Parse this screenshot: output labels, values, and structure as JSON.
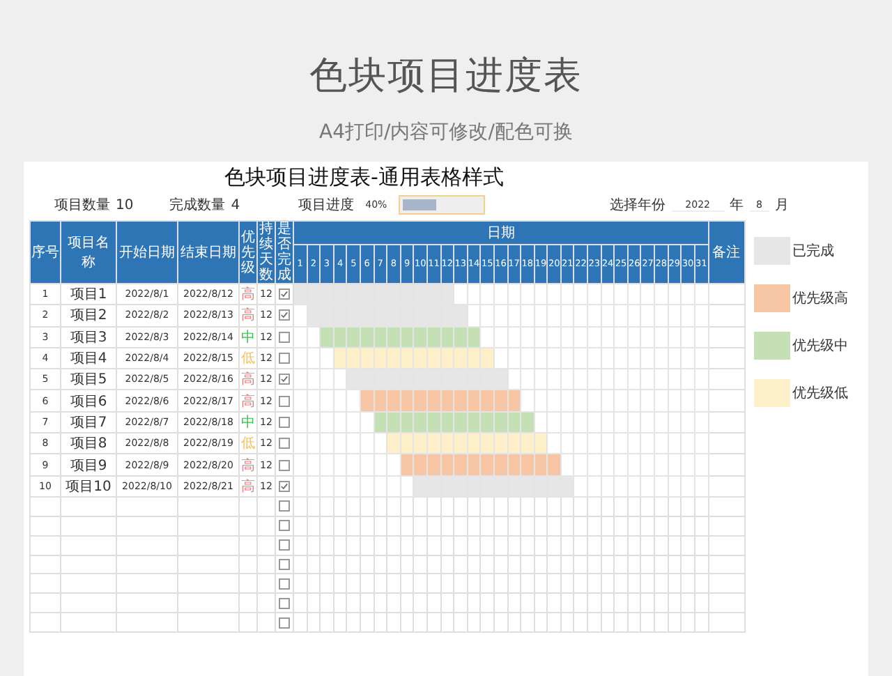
{
  "page_title": "色块项目进度表",
  "subtitle": "A4打印/内容可修改/配色可换",
  "sheet": {
    "title": "色块项目进度表-通用表格样式",
    "summary": {
      "count_label": "项目数量",
      "count": "10",
      "done_label": "完成数量",
      "done": "4",
      "progress_label": "项目进度",
      "progress_text": "40%",
      "level": 0.4,
      "year_label": "选择年份",
      "year": "2022",
      "year_unit": "年",
      "month": "8",
      "month_unit": "月"
    },
    "columns": [
      "序号",
      "项目名称",
      "开始日期",
      "结束日期",
      "优先级",
      "持续天数",
      "是否完成"
    ],
    "date_header": "日期",
    "days": [
      "1",
      "2",
      "3",
      "4",
      "5",
      "6",
      "7",
      "8",
      "9",
      "10",
      "11",
      "12",
      "13",
      "14",
      "15",
      "16",
      "17",
      "18",
      "19",
      "20",
      "21",
      "22",
      "23",
      "24",
      "25",
      "26",
      "27",
      "28",
      "29",
      "30",
      "31"
    ],
    "remark_header": "备注",
    "rows": [
      {
        "no": "1",
        "name": "项目1",
        "start": "2022/8/1",
        "end": "2022/8/12",
        "priority": "高",
        "kind": "high",
        "days": "12",
        "done": true,
        "timeline": [
          true,
          true,
          true,
          true,
          true,
          true,
          true,
          true,
          true,
          true,
          true,
          true,
          false,
          false,
          false,
          false,
          false,
          false,
          false,
          false,
          false,
          false,
          false,
          false,
          false,
          false,
          false,
          false,
          false,
          false,
          false
        ]
      },
      {
        "no": "2",
        "name": "项目2",
        "start": "2022/8/2",
        "end": "2022/8/13",
        "priority": "高",
        "kind": "high",
        "days": "12",
        "done": true,
        "timeline": [
          false,
          true,
          true,
          true,
          true,
          true,
          true,
          true,
          true,
          true,
          true,
          true,
          true,
          false,
          false,
          false,
          false,
          false,
          false,
          false,
          false,
          false,
          false,
          false,
          false,
          false,
          false,
          false,
          false,
          false,
          false
        ]
      },
      {
        "no": "3",
        "name": "项目3",
        "start": "2022/8/3",
        "end": "2022/8/14",
        "priority": "中",
        "kind": "medium",
        "days": "12",
        "done": false,
        "timeline": [
          false,
          false,
          true,
          true,
          true,
          true,
          true,
          true,
          true,
          true,
          true,
          true,
          true,
          true,
          false,
          false,
          false,
          false,
          false,
          false,
          false,
          false,
          false,
          false,
          false,
          false,
          false,
          false,
          false,
          false,
          false
        ]
      },
      {
        "no": "4",
        "name": "项目4",
        "start": "2022/8/4",
        "end": "2022/8/15",
        "priority": "低",
        "kind": "low",
        "days": "12",
        "done": false,
        "timeline": [
          false,
          false,
          false,
          true,
          true,
          true,
          true,
          true,
          true,
          true,
          true,
          true,
          true,
          true,
          true,
          false,
          false,
          false,
          false,
          false,
          false,
          false,
          false,
          false,
          false,
          false,
          false,
          false,
          false,
          false,
          false
        ]
      },
      {
        "no": "5",
        "name": "项目5",
        "start": "2022/8/5",
        "end": "2022/8/16",
        "priority": "高",
        "kind": "high",
        "days": "12",
        "done": true,
        "timeline": [
          false,
          false,
          false,
          false,
          true,
          true,
          true,
          true,
          true,
          true,
          true,
          true,
          true,
          true,
          true,
          true,
          false,
          false,
          false,
          false,
          false,
          false,
          false,
          false,
          false,
          false,
          false,
          false,
          false,
          false,
          false
        ]
      },
      {
        "no": "6",
        "name": "项目6",
        "start": "2022/8/6",
        "end": "2022/8/17",
        "priority": "高",
        "kind": "high",
        "days": "12",
        "done": false,
        "timeline": [
          false,
          false,
          false,
          false,
          false,
          true,
          true,
          true,
          true,
          true,
          true,
          true,
          true,
          true,
          true,
          true,
          true,
          false,
          false,
          false,
          false,
          false,
          false,
          false,
          false,
          false,
          false,
          false,
          false,
          false,
          false
        ]
      },
      {
        "no": "7",
        "name": "项目7",
        "start": "2022/8/7",
        "end": "2022/8/18",
        "priority": "中",
        "kind": "medium",
        "days": "12",
        "done": false,
        "timeline": [
          false,
          false,
          false,
          false,
          false,
          false,
          true,
          true,
          true,
          true,
          true,
          true,
          true,
          true,
          true,
          true,
          true,
          true,
          false,
          false,
          false,
          false,
          false,
          false,
          false,
          false,
          false,
          false,
          false,
          false,
          false
        ]
      },
      {
        "no": "8",
        "name": "项目8",
        "start": "2022/8/8",
        "end": "2022/8/19",
        "priority": "低",
        "kind": "low",
        "days": "12",
        "done": false,
        "timeline": [
          false,
          false,
          false,
          false,
          false,
          false,
          false,
          true,
          true,
          true,
          true,
          true,
          true,
          true,
          true,
          true,
          true,
          true,
          true,
          false,
          false,
          false,
          false,
          false,
          false,
          false,
          false,
          false,
          false,
          false,
          false
        ]
      },
      {
        "no": "9",
        "name": "项目9",
        "start": "2022/8/9",
        "end": "2022/8/20",
        "priority": "高",
        "kind": "high",
        "days": "12",
        "done": false,
        "timeline": [
          false,
          false,
          false,
          false,
          false,
          false,
          false,
          false,
          true,
          true,
          true,
          true,
          true,
          true,
          true,
          true,
          true,
          true,
          true,
          true,
          false,
          false,
          false,
          false,
          false,
          false,
          false,
          false,
          false,
          false,
          false
        ]
      },
      {
        "no": "10",
        "name": "项目10",
        "start": "2022/8/10",
        "end": "2022/8/21",
        "priority": "高",
        "kind": "high",
        "days": "12",
        "done": true,
        "timeline": [
          false,
          false,
          false,
          false,
          false,
          false,
          false,
          false,
          false,
          true,
          true,
          true,
          true,
          true,
          true,
          true,
          true,
          true,
          true,
          true,
          true,
          false,
          false,
          false,
          false,
          false,
          false,
          false,
          false,
          false,
          false
        ]
      }
    ],
    "empty_rows": [
      {
        "done": false
      },
      {
        "done": false
      },
      {
        "done": false
      },
      {
        "done": false
      },
      {
        "done": false
      },
      {
        "done": false
      },
      {
        "done": false
      }
    ],
    "legend": [
      {
        "label": "已完成",
        "kind": "done",
        "color": "#e6e6e6"
      },
      {
        "label": "优先级高",
        "kind": "high",
        "color": "#f6c6a4"
      },
      {
        "label": "优先级中",
        "kind": "medium",
        "color": "#c5e0b4"
      },
      {
        "label": "优先级低",
        "kind": "low",
        "color": "#fdf0c8"
      }
    ]
  }
}
